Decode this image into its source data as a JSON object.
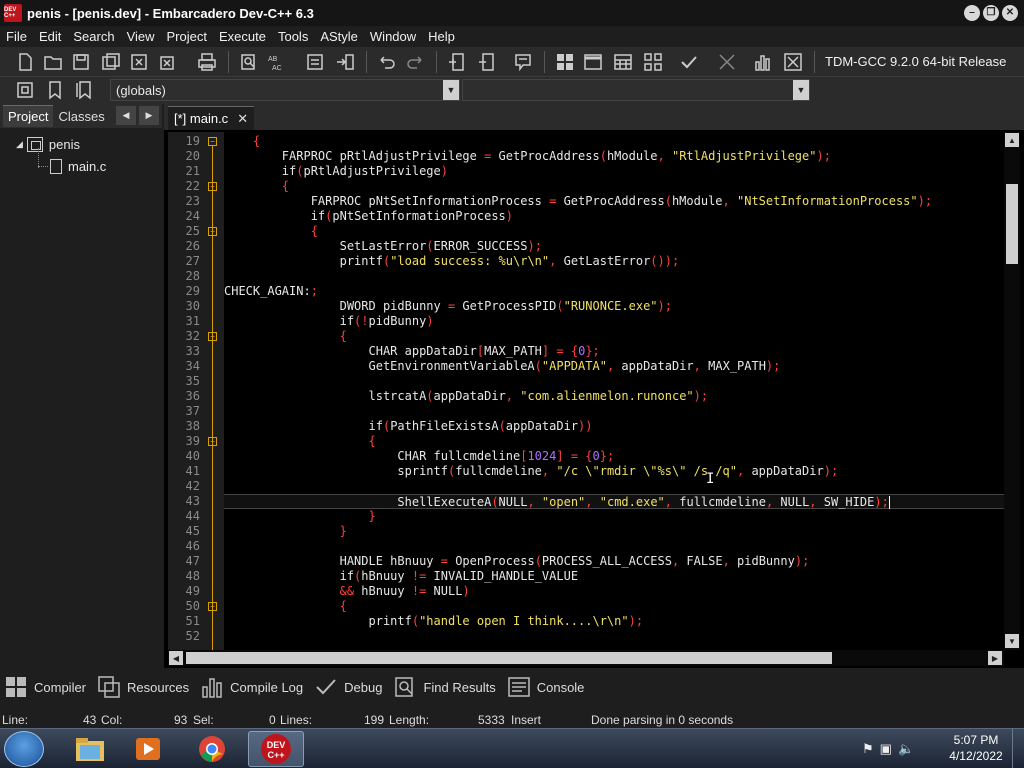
{
  "window": {
    "title": "penis - [penis.dev] - Embarcadero Dev-C++ 6.3",
    "icon_text": "DEV C++"
  },
  "menu": [
    "File",
    "Edit",
    "Search",
    "View",
    "Project",
    "Execute",
    "Tools",
    "AStyle",
    "Window",
    "Help"
  ],
  "toolbar": {
    "compiler": "TDM-GCC 9.2.0 64-bit Release",
    "scope": "(globals)"
  },
  "left_panel": {
    "tabs": [
      "Project",
      "Classes"
    ],
    "project_name": "penis",
    "file": "main.c"
  },
  "editor": {
    "tab": "[*] main.c",
    "lines": [
      {
        "n": "19",
        "t": "    {"
      },
      {
        "n": "20",
        "t": "        FARPROC pRtlAdjustPrivilege = GetProcAddress(hModule, \"RtlAdjustPrivilege\");"
      },
      {
        "n": "21",
        "t": "        if(pRtlAdjustPrivilege)"
      },
      {
        "n": "22",
        "t": "        {"
      },
      {
        "n": "23",
        "t": "            FARPROC pNtSetInformationProcess = GetProcAddress(hModule, \"NtSetInformationProcess\");"
      },
      {
        "n": "24",
        "t": "            if(pNtSetInformationProcess)"
      },
      {
        "n": "25",
        "t": "            {"
      },
      {
        "n": "26",
        "t": "                SetLastError(ERROR_SUCCESS);"
      },
      {
        "n": "27",
        "t": "                printf(\"load success: %u\\r\\n\", GetLastError());"
      },
      {
        "n": "28",
        "t": ""
      },
      {
        "n": "29",
        "t": "CHECK_AGAIN:;"
      },
      {
        "n": "30",
        "t": "                DWORD pidBunny = GetProcessPID(\"RUNONCE.exe\");"
      },
      {
        "n": "31",
        "t": "                if(!pidBunny)"
      },
      {
        "n": "32",
        "t": "                {"
      },
      {
        "n": "33",
        "t": "                    CHAR appDataDir[MAX_PATH] = {0};"
      },
      {
        "n": "34",
        "t": "                    GetEnvironmentVariableA(\"APPDATA\", appDataDir, MAX_PATH);"
      },
      {
        "n": "35",
        "t": ""
      },
      {
        "n": "36",
        "t": "                    lstrcatA(appDataDir, \"com.alienmelon.runonce\");"
      },
      {
        "n": "37",
        "t": ""
      },
      {
        "n": "38",
        "t": "                    if(PathFileExistsA(appDataDir))"
      },
      {
        "n": "39",
        "t": "                    {"
      },
      {
        "n": "40",
        "t": "                        CHAR fullcmdeline[1024] = {0};"
      },
      {
        "n": "41",
        "t": "                        sprintf(fullcmdeline, \"/c \\\"rmdir \\\"%s\\\" /s /q\", appDataDir);"
      },
      {
        "n": "42",
        "t": ""
      },
      {
        "n": "43",
        "t": "                        ShellExecuteA(NULL, \"open\", \"cmd.exe\", fullcmdeline, NULL, SW_HIDE);"
      },
      {
        "n": "44",
        "t": "                    }"
      },
      {
        "n": "45",
        "t": "                }"
      },
      {
        "n": "46",
        "t": ""
      },
      {
        "n": "47",
        "t": "                HANDLE hBnuuy = OpenProcess(PROCESS_ALL_ACCESS, FALSE, pidBunny);"
      },
      {
        "n": "48",
        "t": "                if(hBnuuy != INVALID_HANDLE_VALUE"
      },
      {
        "n": "49",
        "t": "                && hBnuuy != NULL)"
      },
      {
        "n": "50",
        "t": "                {"
      },
      {
        "n": "51",
        "t": "                    printf(\"handle open I think....\\r\\n\");"
      },
      {
        "n": "52",
        "t": ""
      }
    ]
  },
  "bottom_tabs": [
    "Compiler",
    "Resources",
    "Compile Log",
    "Debug",
    "Find Results",
    "Console"
  ],
  "status": {
    "line_label": "Line:",
    "line": "43",
    "col_label": "Col:",
    "col": "93",
    "sel_label": "Sel:",
    "sel": "0",
    "lines_label": "Lines:",
    "lines": "199",
    "length_label": "Length:",
    "length": "5333",
    "mode": "Insert",
    "message": "Done parsing in 0 seconds"
  },
  "taskbar": {
    "time": "5:07 PM",
    "date": "4/12/2022"
  },
  "colors": {
    "keyword": "#e8e8e8",
    "string": "#f0e060",
    "number": "#b070ff",
    "symbol": "#ff4040",
    "fold": "#d8a000"
  }
}
